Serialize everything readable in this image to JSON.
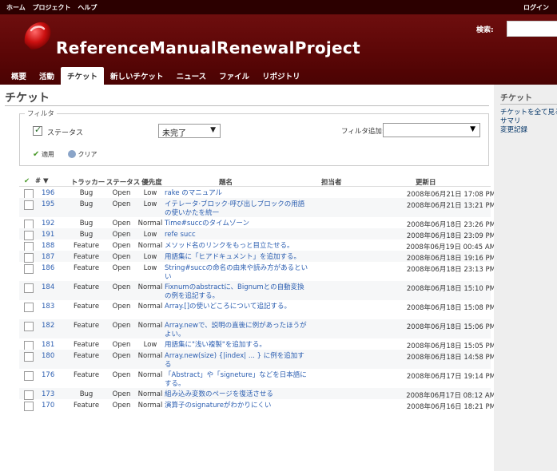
{
  "topbar": {
    "links": [
      "ホーム",
      "プロジェクト",
      "ヘルプ"
    ],
    "login": "ログイン"
  },
  "header": {
    "project_title": "ReferenceManualRenewalProject",
    "search_label": "検索:",
    "search_value": "",
    "menu": [
      "概要",
      "活動",
      "チケット",
      "新しいチケット",
      "ニュース",
      "ファイル",
      "リポジトリ"
    ],
    "active_menu": "チケット"
  },
  "main": {
    "page_title": "チケット",
    "filters": {
      "legend": "フィルタ",
      "status_label": "ステータス",
      "status_checked": true,
      "status_operator": "未完了",
      "add_filter_label": "フィルタ追加:",
      "add_filter_value": "",
      "apply_label": "適用",
      "clear_label": "クリア"
    },
    "table": {
      "headers": {
        "id": "#",
        "tracker": "トラッカー",
        "status": "ステータス",
        "priority": "優先度",
        "subject": "題名",
        "assignee": "担当者",
        "updated": "更新日"
      },
      "rows": [
        {
          "id": "196",
          "tracker": "Bug",
          "status": "Open",
          "priority": "Low",
          "subject": "rake のマニュアル",
          "updated": "2008年06月21日 17:08 PM"
        },
        {
          "id": "195",
          "tracker": "Bug",
          "status": "Open",
          "priority": "Low",
          "subject": "イテレータ·ブロック·呼び出しブロックの用語の使いかたを統一",
          "updated": "2008年06月21日 13:21 PM"
        },
        {
          "id": "192",
          "tracker": "Bug",
          "status": "Open",
          "priority": "Normal",
          "subject": "Time#succのタイムゾーン",
          "updated": "2008年06月18日 23:26 PM"
        },
        {
          "id": "191",
          "tracker": "Bug",
          "status": "Open",
          "priority": "Low",
          "subject": "refe succ",
          "updated": "2008年06月18日 23:09 PM"
        },
        {
          "id": "188",
          "tracker": "Feature",
          "status": "Open",
          "priority": "Normal",
          "subject": "メソッド名のリンクをもっと目立たせる。",
          "updated": "2008年06月19日 00:45 AM"
        },
        {
          "id": "187",
          "tracker": "Feature",
          "status": "Open",
          "priority": "Low",
          "subject": "用語集に「ヒアドキュメント」を追加する。",
          "updated": "2008年06月18日 19:16 PM"
        },
        {
          "id": "186",
          "tracker": "Feature",
          "status": "Open",
          "priority": "Low",
          "subject": "String#succの命名の由来や読み方があるといい",
          "updated": "2008年06月18日 23:13 PM"
        },
        {
          "id": "184",
          "tracker": "Feature",
          "status": "Open",
          "priority": "Normal",
          "subject": "Fixnumのabstractに、Bignumとの自動変換の例を追記する。",
          "updated": "2008年06月18日 15:10 PM"
        },
        {
          "id": "183",
          "tracker": "Feature",
          "status": "Open",
          "priority": "Normal",
          "subject": "Array.[]の使いどころについて追記する。",
          "updated": "2008年06月18日 15:08 PM"
        },
        {
          "id": "182",
          "tracker": "Feature",
          "status": "Open",
          "priority": "Normal",
          "subject": "Array.newで、説明の直後に例があったほうがよい。",
          "updated": "2008年06月18日 15:06 PM"
        },
        {
          "id": "181",
          "tracker": "Feature",
          "status": "Open",
          "priority": "Low",
          "subject": "用語集に\"浅い複製\"を追加する。",
          "updated": "2008年06月18日 15:05 PM"
        },
        {
          "id": "180",
          "tracker": "Feature",
          "status": "Open",
          "priority": "Normal",
          "subject": "Array.new(size) {|index| ... } に例を追加する",
          "updated": "2008年06月18日 14:58 PM"
        },
        {
          "id": "176",
          "tracker": "Feature",
          "status": "Open",
          "priority": "Normal",
          "subject": "「Abstract」や「signeture」などを日本語にする。",
          "updated": "2008年06月17日 19:14 PM"
        },
        {
          "id": "173",
          "tracker": "Bug",
          "status": "Open",
          "priority": "Normal",
          "subject": "組み込み変数のページを復活させる",
          "updated": "2008年06月17日 08:12 AM"
        },
        {
          "id": "170",
          "tracker": "Feature",
          "status": "Open",
          "priority": "Normal",
          "subject": "演算子のsignatureがわかりにくい",
          "updated": "2008年06月16日 18:21 PM"
        }
      ]
    }
  },
  "sidebar": {
    "heading": "チケット",
    "links": [
      "チケットを全て見る",
      "サマリ",
      "変更記録"
    ]
  },
  "colors": {
    "header_bg": "#5a0606",
    "topbar_bg": "#2c0000",
    "link": "#2a5db0",
    "sidebar_bg": "#eeeeee"
  }
}
